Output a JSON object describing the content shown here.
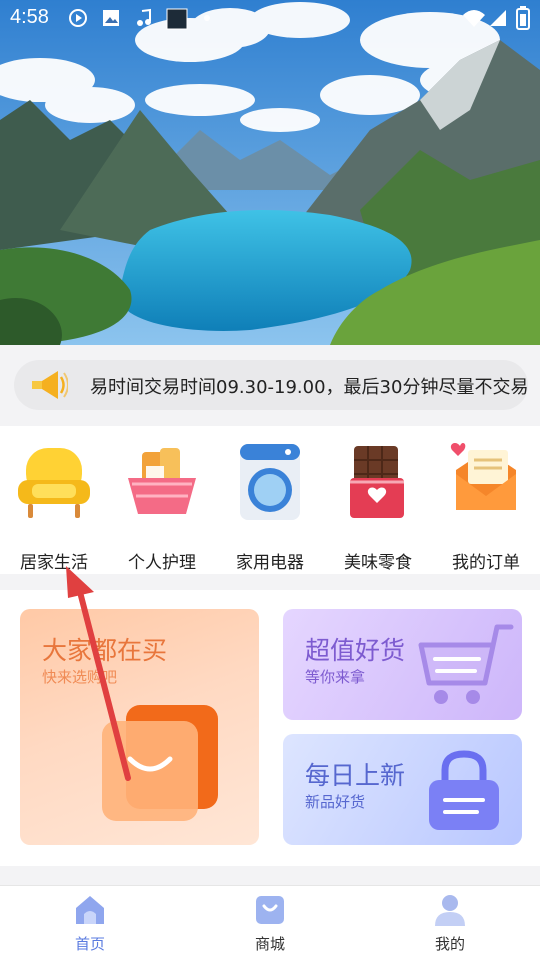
{
  "status_bar": {
    "time": "4:58",
    "icons": [
      "play-circle-icon",
      "image-icon",
      "music-icon",
      "app-square-icon",
      "dot-icon",
      "wifi-icon",
      "signal-icon",
      "battery-icon"
    ]
  },
  "notice": {
    "icon": "megaphone-icon",
    "text": "易时间交易时间09.30-19.00，最后30分钟尽量不交易"
  },
  "categories": [
    {
      "label": "居家生活",
      "icon": "armchair-icon"
    },
    {
      "label": "个人护理",
      "icon": "basket-icon"
    },
    {
      "label": "家用电器",
      "icon": "washing-machine-icon"
    },
    {
      "label": "美味零食",
      "icon": "chocolate-icon"
    },
    {
      "label": "我的订单",
      "icon": "envelope-heart-icon"
    }
  ],
  "promos": {
    "big": {
      "title": "大家都在买",
      "subtitle": "快来选购吧",
      "icon": "shopping-bag-icon"
    },
    "purple": {
      "title": "超值好货",
      "subtitle": "等你来拿",
      "icon": "shopping-cart-icon"
    },
    "blue": {
      "title": "每日上新",
      "subtitle": "新品好货",
      "icon": "handbag-icon"
    }
  },
  "bottom_nav": [
    {
      "label": "首页",
      "icon": "home-icon",
      "active": true
    },
    {
      "label": "商城",
      "icon": "shop-bag-icon",
      "active": false
    },
    {
      "label": "我的",
      "icon": "user-icon",
      "active": false
    }
  ],
  "colors": {
    "accent": "#5a7be0",
    "promo_orange": "#e8763c",
    "promo_purple": "#7d5bd0",
    "promo_blue": "#5667cf",
    "annotation_arrow": "#e04040"
  }
}
